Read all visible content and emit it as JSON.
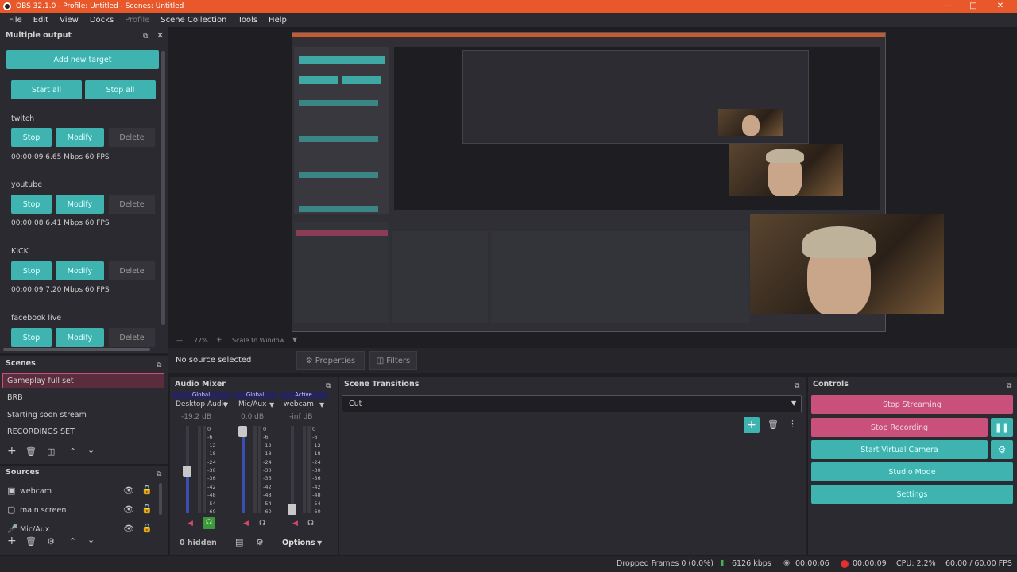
{
  "window": {
    "title": "OBS 32.1.0 - Profile: Untitled - Scenes: Untitled"
  },
  "menu": [
    {
      "label": "File",
      "disabled": false
    },
    {
      "label": "Edit",
      "disabled": false
    },
    {
      "label": "View",
      "disabled": false
    },
    {
      "label": "Docks",
      "disabled": false
    },
    {
      "label": "Profile",
      "disabled": true
    },
    {
      "label": "Scene Collection",
      "disabled": false
    },
    {
      "label": "Tools",
      "disabled": false
    },
    {
      "label": "Help",
      "disabled": false
    }
  ],
  "multi_output": {
    "title": "Multiple output",
    "add_target": "Add new target",
    "start_all": "Start all",
    "stop_all": "Stop all",
    "targets": [
      {
        "name": "twitch",
        "stop": "Stop",
        "modify": "Modify",
        "delete": "Delete",
        "stats": "00:00:09  6.65 Mbps  60 FPS"
      },
      {
        "name": "youtube",
        "stop": "Stop",
        "modify": "Modify",
        "delete": "Delete",
        "stats": "00:00:08  6.41 Mbps  60 FPS"
      },
      {
        "name": "KICK",
        "stop": "Stop",
        "modify": "Modify",
        "delete": "Delete",
        "stats": "00:00:09  7.20 Mbps  60 FPS"
      },
      {
        "name": "facebook live",
        "stop": "Stop",
        "modify": "Modify",
        "delete": "Delete"
      }
    ]
  },
  "preview": {
    "zoom": "77%",
    "scale": "Scale to Window"
  },
  "source_bar": {
    "status": "No source selected",
    "properties": "Properties",
    "filters": "Filters"
  },
  "scenes": {
    "title": "Scenes",
    "items": [
      "Gameplay full set",
      "BRB",
      "Starting soon stream",
      "RECORDINGS SET"
    ],
    "selected": 0
  },
  "sources": {
    "title": "Sources",
    "items": [
      "webcam",
      "main screen",
      "Mic/Aux"
    ]
  },
  "audio_mixer": {
    "title": "Audio Mixer",
    "channels": [
      {
        "scope": "Global",
        "name": "Desktop Audio",
        "db": "-19.2 dB",
        "level": 0.45
      },
      {
        "scope": "Global",
        "name": "Mic/Aux",
        "db": "0.0 dB",
        "level": 1.0
      },
      {
        "scope": "Active",
        "name": "webcam",
        "db": "-inf dB",
        "level": 0.0
      }
    ],
    "scale": [
      "0",
      "-6",
      "-12",
      "-18",
      "-24",
      "-30",
      "-36",
      "-42",
      "-48",
      "-54",
      "-60"
    ],
    "hidden": "0 hidden",
    "options": "Options"
  },
  "scene_transitions": {
    "title": "Scene Transitions",
    "selected": "Cut"
  },
  "controls": {
    "title": "Controls",
    "stop_streaming": "Stop Streaming",
    "stop_recording": "Stop Recording",
    "start_virtual_camera": "Start Virtual Camera",
    "studio_mode": "Studio Mode",
    "settings": "Settings"
  },
  "status": {
    "dropped": "Dropped Frames 0 (0.0%)",
    "bitrate": "6126 kbps",
    "stream_time": "00:00:06",
    "rec_time": "00:00:09",
    "cpu": "CPU: 2.2%",
    "fps": "60.00 / 60.00 FPS"
  },
  "colors": {
    "accent": "#3fb3b0",
    "record": "#c8507b",
    "titlebar": "#e8582a"
  }
}
